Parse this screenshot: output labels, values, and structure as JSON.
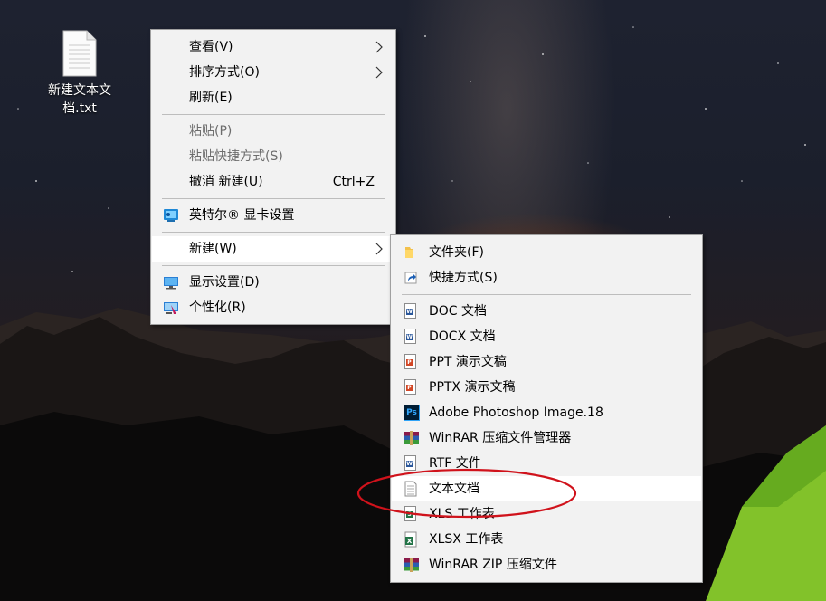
{
  "desktop": {
    "file_icon_label_line1": "新建文本文",
    "file_icon_label_line2": "档.txt"
  },
  "context_menu": {
    "view": "查看(V)",
    "sort_by": "排序方式(O)",
    "refresh": "刷新(E)",
    "paste": "粘贴(P)",
    "paste_shortcut": "粘贴快捷方式(S)",
    "undo_new": "撤消 新建(U)",
    "undo_shortcut": "Ctrl+Z",
    "intel_graphics": "英特尔® 显卡设置",
    "new": "新建(W)",
    "display_settings": "显示设置(D)",
    "personalize": "个性化(R)"
  },
  "new_submenu": {
    "folder": "文件夹(F)",
    "shortcut": "快捷方式(S)",
    "doc": "DOC 文档",
    "docx": "DOCX 文档",
    "ppt": "PPT 演示文稿",
    "pptx": "PPTX 演示文稿",
    "photoshop": "Adobe Photoshop Image.18",
    "winrar": "WinRAR 压缩文件管理器",
    "rtf": "RTF 文件",
    "text": "文本文档",
    "xls": "XLS 工作表",
    "xlsx": "XLSX 工作表",
    "winrar_zip": "WinRAR ZIP 压缩文件"
  },
  "icons": {
    "doc": "W",
    "ppt": "P",
    "xls": "S",
    "photoshop": "Ps"
  },
  "colors": {
    "menu_bg": "#f2f2f2",
    "highlight": "#ffffff",
    "annotation_ellipse": "#d0121b",
    "word_blue": "#2b579a",
    "ppt_orange": "#d24726",
    "excel_green": "#217346"
  }
}
